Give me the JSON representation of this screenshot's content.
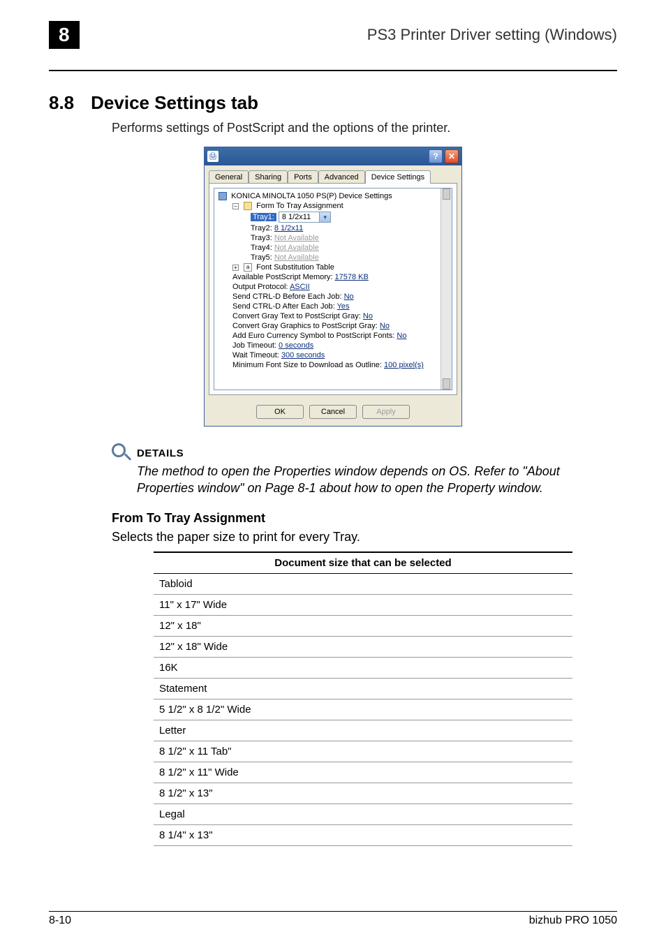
{
  "header": {
    "chapter": "8",
    "title": "PS3 Printer Driver setting (Windows)"
  },
  "section": {
    "number": "8.8",
    "title": "Device Settings tab",
    "intro": "Performs settings of PostScript and the options of the printer."
  },
  "dialog": {
    "tabs": [
      "General",
      "Sharing",
      "Ports",
      "Advanced",
      "Device Settings"
    ],
    "active_tab_index": 4,
    "tree": {
      "root": "KONICA MINOLTA 1050 PS(P) Device Settings",
      "form_to_tray_label": "Form To Tray Assignment",
      "tray1_label": "Tray1:",
      "tray1_value": "8 1/2x11",
      "tray2": "Tray2: ",
      "tray2_val": "8 1/2x11",
      "tray3": "Tray3: ",
      "tray3_val": "Not Available",
      "tray4": "Tray4: ",
      "tray4_val": "Not Available",
      "tray5": "Tray5: ",
      "tray5_val": "Not Available",
      "font_sub": "Font Substitution Table",
      "ps_mem": "Available PostScript Memory: ",
      "ps_mem_val": "17578 KB",
      "out_proto": "Output Protocol: ",
      "out_proto_val": "ASCII",
      "ctrld_before": "Send CTRL-D Before Each Job: ",
      "ctrld_before_val": "No",
      "ctrld_after": "Send CTRL-D After Each Job: ",
      "ctrld_after_val": "Yes",
      "gray_text": "Convert Gray Text to PostScript Gray: ",
      "gray_text_val": "No",
      "gray_gfx": "Convert Gray Graphics to PostScript Gray: ",
      "gray_gfx_val": "No",
      "euro": "Add Euro Currency Symbol to PostScript Fonts: ",
      "euro_val": "No",
      "job_timeout": "Job Timeout: ",
      "job_timeout_val": "0 seconds",
      "wait_timeout": "Wait Timeout: ",
      "wait_timeout_val": "300 seconds",
      "min_font": "Minimum Font Size to Download as Outline: ",
      "min_font_val": "100 pixel(s)"
    },
    "buttons": {
      "ok": "OK",
      "cancel": "Cancel",
      "apply": "Apply"
    }
  },
  "details": {
    "label": "DETAILS",
    "text": "The method to open the Properties window depends on OS. Refer to \"About Properties window\" on Page 8-1 about how to open the Property window."
  },
  "from_to_tray": {
    "heading": "From To Tray Assignment",
    "desc": "Selects the paper size to print for every Tray.",
    "table_header": "Document size that can be selected",
    "rows": [
      "Tabloid",
      "11\" x 17\" Wide",
      "12\" x 18\"",
      "12\" x 18\" Wide",
      "16K",
      "Statement",
      "5 1/2\" x 8 1/2\" Wide",
      "Letter",
      "8 1/2\" x 11 Tab\"",
      "8 1/2\" x 11\" Wide",
      "8 1/2\" x 13\"",
      "Legal",
      "8 1/4\" x 13\""
    ]
  },
  "footer": {
    "left": "8-10",
    "right": "bizhub PRO 1050"
  }
}
